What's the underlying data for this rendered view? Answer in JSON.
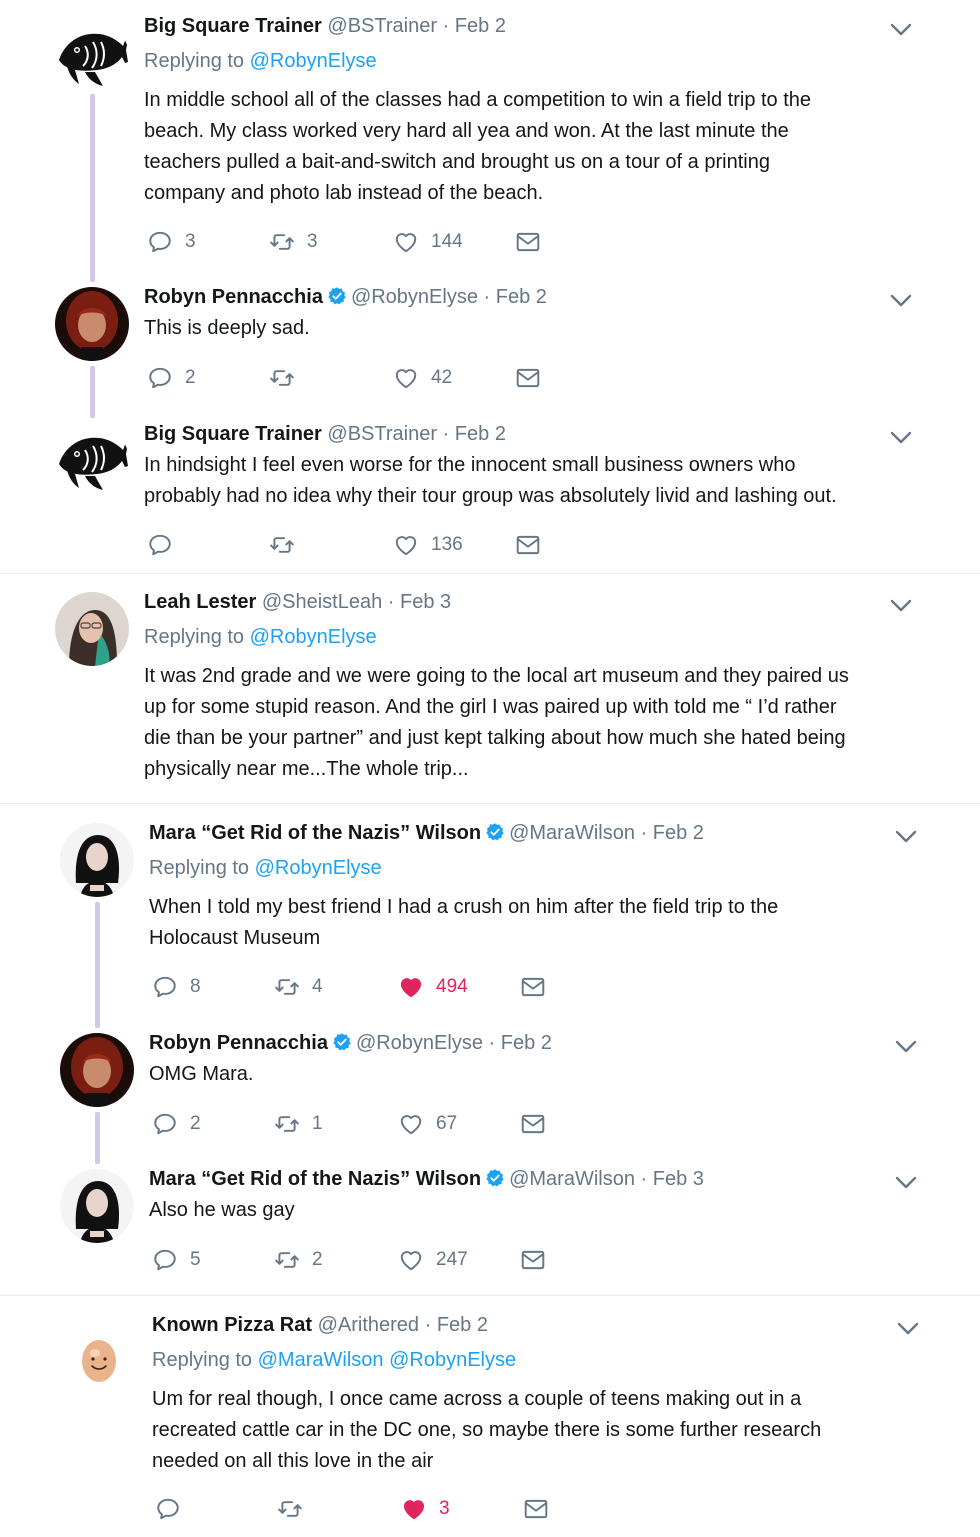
{
  "tweets": [
    {
      "name": "Big Square Trainer",
      "handle": "@BSTrainer",
      "date": "Feb 2",
      "replying_prefix": "Replying to",
      "replying_to": [
        "@RobynElyse"
      ],
      "lines": [
        "In middle school all of the classes had a competition to win a field trip to the",
        "beach. My class worked very hard all yea and won. At the last minute the",
        "teachers pulled a bait-and-switch and brought us on a tour of a printing",
        "company and photo lab instead of the beach."
      ],
      "replies": "3",
      "retweets": "3",
      "likes": "144",
      "liked": false,
      "verified": false
    },
    {
      "name": "Robyn Pennacchia",
      "handle": "@RobynElyse",
      "date": "Feb 2",
      "lines": [
        "This is deeply sad."
      ],
      "replies": "2",
      "retweets": "",
      "likes": "42",
      "liked": false,
      "verified": true
    },
    {
      "name": "Big Square Trainer",
      "handle": "@BSTrainer",
      "date": "Feb 2",
      "lines": [
        "In hindsight I feel even worse for the innocent small business owners who",
        "probably had no idea why their tour group was absolutely livid and lashing out."
      ],
      "replies": "",
      "retweets": "",
      "likes": "136",
      "liked": false,
      "verified": false
    },
    {
      "name": "Leah Lester",
      "handle": "@SheistLeah",
      "date": "Feb 3",
      "replying_prefix": "Replying to",
      "replying_to": [
        "@RobynElyse"
      ],
      "lines": [
        "It was 2nd grade and we were going to the local art museum and they paired us",
        "up for some stupid reason. And the girl I was paired up with told me “ I’d rather",
        "die than be your partner” and just kept talking about how much she hated being",
        "physically near me...The whole trip..."
      ],
      "verified": false
    },
    {
      "name": "Mara “Get Rid of the Nazis” Wilson",
      "handle": "@MaraWilson",
      "date": "Feb 2",
      "replying_prefix": "Replying to",
      "replying_to": [
        "@RobynElyse"
      ],
      "lines": [
        "When I told my best friend I had a crush on him after the field trip to the",
        "Holocaust Museum"
      ],
      "replies": "8",
      "retweets": "4",
      "likes": "494",
      "liked": true,
      "verified": true
    },
    {
      "name": "Robyn Pennacchia",
      "handle": "@RobynElyse",
      "date": "Feb 2",
      "lines": [
        "OMG Mara."
      ],
      "replies": "2",
      "retweets": "1",
      "likes": "67",
      "liked": false,
      "verified": true
    },
    {
      "name": "Mara “Get Rid of the Nazis” Wilson",
      "handle": "@MaraWilson",
      "date": "Feb 3",
      "lines": [
        "Also he was gay"
      ],
      "replies": "5",
      "retweets": "2",
      "likes": "247",
      "liked": false,
      "verified": true
    },
    {
      "name": "Known Pizza Rat",
      "handle": "@Arithered",
      "date": "Feb 2",
      "replying_prefix": "Replying to",
      "replying_to": [
        "@MaraWilson",
        "@RobynElyse"
      ],
      "lines": [
        "Um for real though, I once came across a couple of teens making out in a",
        "recreated cattle car in the DC one, so maybe there is some further research",
        "needed on all this love in the air"
      ],
      "replies": "",
      "retweets": "",
      "likes": "3",
      "liked": true,
      "verified": false
    }
  ],
  "separator": "·",
  "icons": {
    "reply": "reply-icon",
    "retweet": "retweet-icon",
    "like": "heart-icon",
    "dm": "envelope-icon",
    "more": "chevron-down-icon",
    "verified": "verified-badge-icon"
  },
  "colors": {
    "link": "#1da1f2",
    "like": "#e0245e",
    "muted": "#657786",
    "thread": "#d2c7e8"
  }
}
